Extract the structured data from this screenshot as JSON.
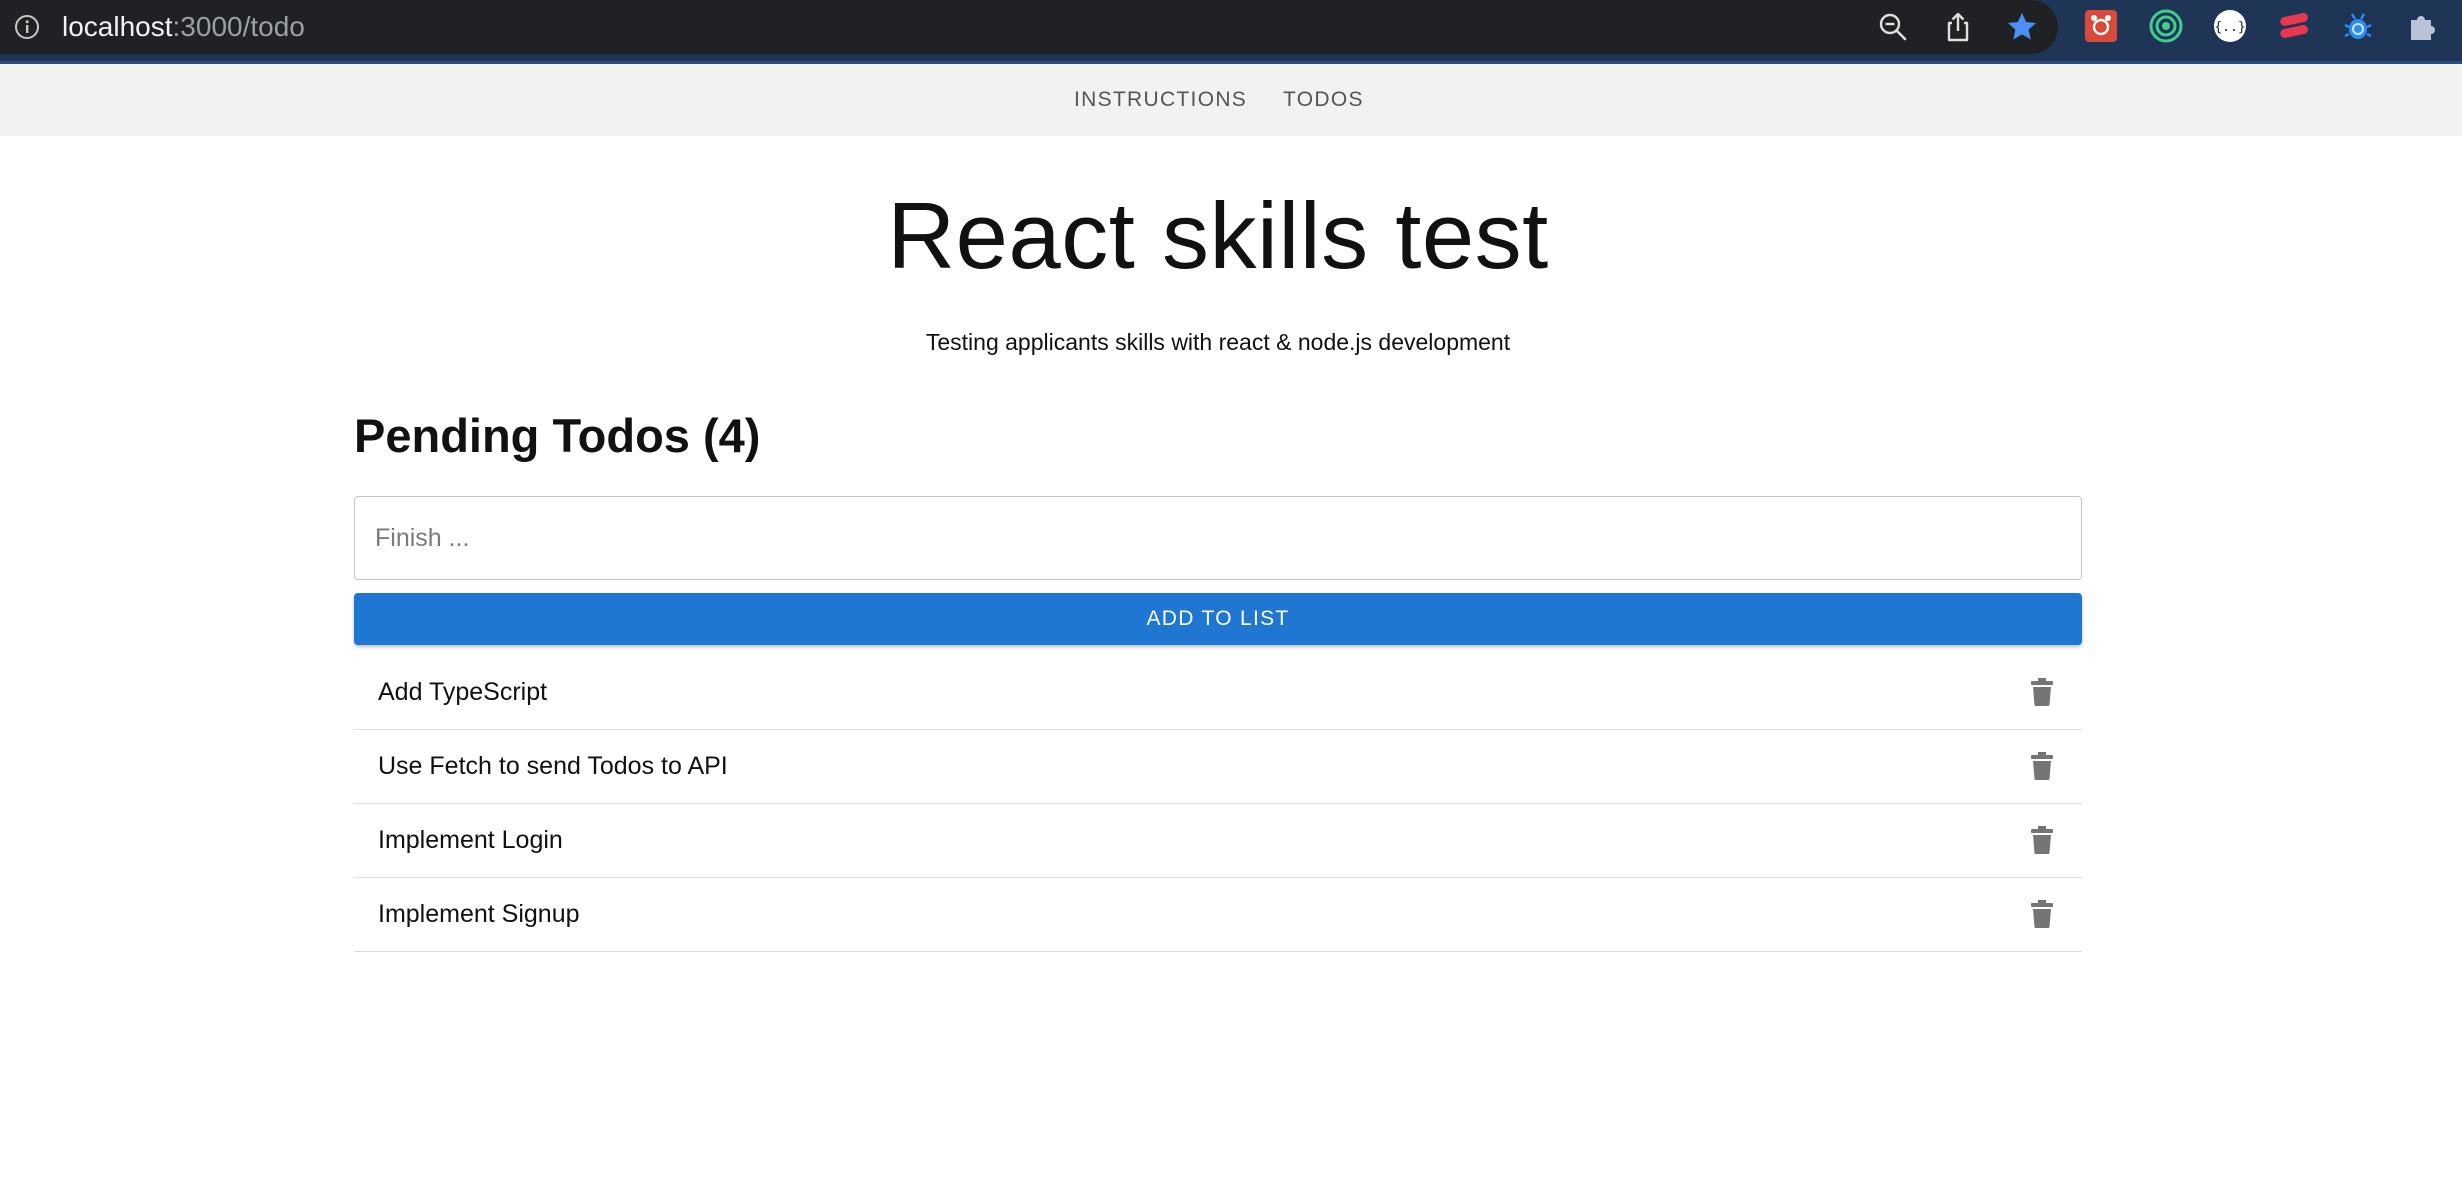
{
  "browser": {
    "url_host": "localhost",
    "url_path": ":3000/todo",
    "toolbar_icons": [
      "info-icon",
      "zoom-out-icon",
      "share-icon",
      "bookmark-star-icon"
    ],
    "extension_icons": [
      "extension-red-icon",
      "extension-target-icon",
      "extension-json-icon",
      "extension-red-e-icon",
      "extension-bug-icon",
      "puzzle-icon"
    ]
  },
  "nav": {
    "instructions_label": "INSTRUCTIONS",
    "todos_label": "TODOS"
  },
  "header": {
    "title": "React skills test",
    "subtitle": "Testing applicants skills with react & node.js development"
  },
  "todos": {
    "section_title": "Pending Todos (4)",
    "input_placeholder": "Finish ...",
    "input_value": "",
    "add_button_label": "ADD TO LIST",
    "items": [
      {
        "text": "Add TypeScript"
      },
      {
        "text": "Use Fetch to send Todos to API"
      },
      {
        "text": "Implement Login"
      },
      {
        "text": "Implement Signup"
      }
    ]
  },
  "colors": {
    "primary": "#1f77d2",
    "chrome_bg": "#1e3556",
    "omnibox_bg": "#202124",
    "nav_bg": "#f2f2f2",
    "icon_grey": "#757575"
  }
}
